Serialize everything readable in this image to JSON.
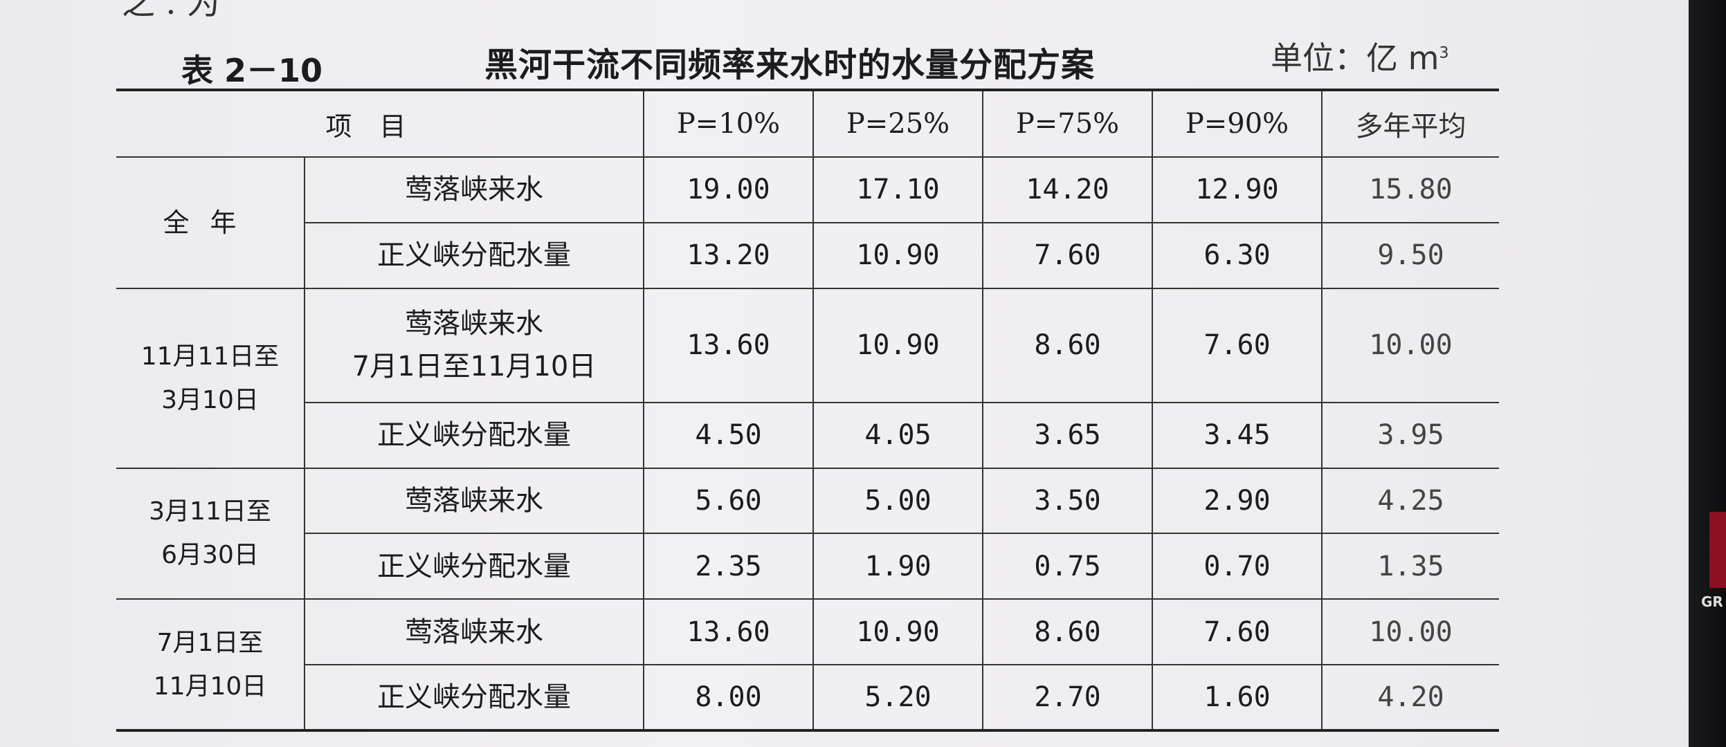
{
  "caption": {
    "number": "表 2－10",
    "title": "黑河干流不同频率来水时的水量分配方案",
    "unit": "单位：亿 m",
    "unit_sup": "3"
  },
  "table": {
    "header_item": "项目",
    "columns": [
      "P=10%",
      "P=25%",
      "P=75%",
      "P=90%",
      "多年平均"
    ],
    "groups": [
      {
        "period_lines": [
          "全年"
        ],
        "rows": [
          {
            "item_lines": [
              "莺落峡来水"
            ],
            "values": [
              "19.00",
              "17.10",
              "14.20",
              "12.90",
              "15.80"
            ]
          },
          {
            "item_lines": [
              "正义峡分配水量"
            ],
            "values": [
              "13.20",
              "10.90",
              "7.60",
              "6.30",
              "9.50"
            ]
          }
        ]
      },
      {
        "period_lines": [
          "11月11日至",
          "3月10日"
        ],
        "rows": [
          {
            "item_lines": [
              "莺落峡来水",
              "7月1日至11月10日"
            ],
            "values": [
              "13.60",
              "10.90",
              "8.60",
              "7.60",
              "10.00"
            ]
          },
          {
            "item_lines": [
              "正义峡分配水量"
            ],
            "values": [
              "4.50",
              "4.05",
              "3.65",
              "3.45",
              "3.95"
            ]
          }
        ]
      },
      {
        "period_lines": [
          "3月11日至",
          "6月30日"
        ],
        "rows": [
          {
            "item_lines": [
              "莺落峡来水"
            ],
            "values": [
              "5.60",
              "5.00",
              "3.50",
              "2.90",
              "4.25"
            ]
          },
          {
            "item_lines": [
              "正义峡分配水量"
            ],
            "values": [
              "2.35",
              "1.90",
              "0.75",
              "0.70",
              "1.35"
            ]
          }
        ]
      },
      {
        "period_lines": [
          "7月1日至",
          "11月10日"
        ],
        "rows": [
          {
            "item_lines": [
              "莺落峡来水"
            ],
            "values": [
              "13.60",
              "10.90",
              "8.60",
              "7.60",
              "10.00"
            ]
          },
          {
            "item_lines": [
              "正义峡分配水量"
            ],
            "values": [
              "8.00",
              "5.20",
              "2.70",
              "1.60",
              "4.20"
            ]
          }
        ]
      }
    ]
  },
  "page_top_fragment": "之 . 为",
  "edge_text": "GR"
}
